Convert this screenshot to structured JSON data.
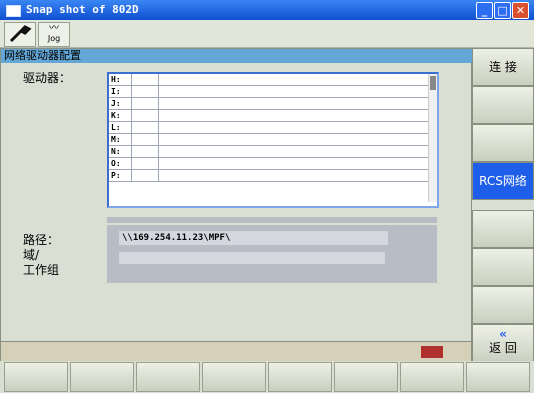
{
  "window": {
    "title": "Snap shot of 802D"
  },
  "toolbar": {
    "jog_label": "Jog"
  },
  "panel": {
    "header": "网络驱动器配置",
    "drive_label": "驱动器：",
    "path_label": "路径：",
    "domain_label": "域/",
    "workgroup_label": "工作组",
    "path_value": "\\\\169.254.11.23\\MPF\\",
    "drives": [
      "H:",
      "I:",
      "J:",
      "K:",
      "L:",
      "M:",
      "N:",
      "O:",
      "P:"
    ]
  },
  "softkeys": {
    "connect": "连 接",
    "rcs_network": "RCS网络",
    "back": "返 回",
    "back_arrows": "«"
  },
  "colors": {
    "titlebar": "#0f4fd0",
    "active_softkey": "#1f5ee8",
    "header": "#62a7d5"
  }
}
